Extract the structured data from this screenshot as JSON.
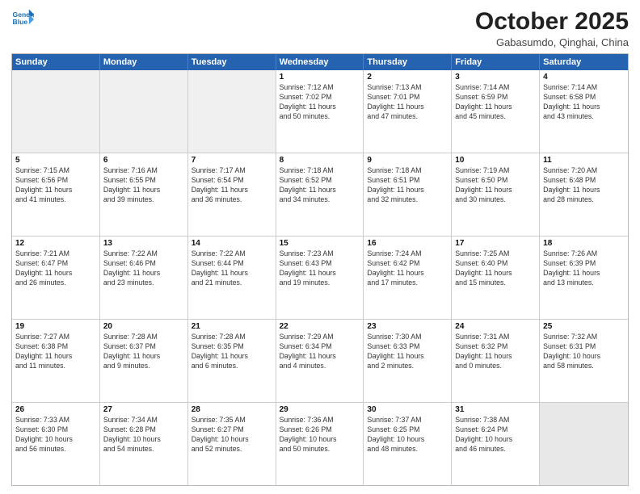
{
  "logo": {
    "line1": "General",
    "line2": "Blue"
  },
  "title": "October 2025",
  "location": "Gabasumdo, Qinghai, China",
  "days_of_week": [
    "Sunday",
    "Monday",
    "Tuesday",
    "Wednesday",
    "Thursday",
    "Friday",
    "Saturday"
  ],
  "weeks": [
    [
      {
        "day": "",
        "info": "",
        "empty": true
      },
      {
        "day": "",
        "info": "",
        "empty": true
      },
      {
        "day": "",
        "info": "",
        "empty": true
      },
      {
        "day": "1",
        "info": "Sunrise: 7:12 AM\nSunset: 7:02 PM\nDaylight: 11 hours\nand 50 minutes."
      },
      {
        "day": "2",
        "info": "Sunrise: 7:13 AM\nSunset: 7:01 PM\nDaylight: 11 hours\nand 47 minutes."
      },
      {
        "day": "3",
        "info": "Sunrise: 7:14 AM\nSunset: 6:59 PM\nDaylight: 11 hours\nand 45 minutes."
      },
      {
        "day": "4",
        "info": "Sunrise: 7:14 AM\nSunset: 6:58 PM\nDaylight: 11 hours\nand 43 minutes."
      }
    ],
    [
      {
        "day": "5",
        "info": "Sunrise: 7:15 AM\nSunset: 6:56 PM\nDaylight: 11 hours\nand 41 minutes."
      },
      {
        "day": "6",
        "info": "Sunrise: 7:16 AM\nSunset: 6:55 PM\nDaylight: 11 hours\nand 39 minutes."
      },
      {
        "day": "7",
        "info": "Sunrise: 7:17 AM\nSunset: 6:54 PM\nDaylight: 11 hours\nand 36 minutes."
      },
      {
        "day": "8",
        "info": "Sunrise: 7:18 AM\nSunset: 6:52 PM\nDaylight: 11 hours\nand 34 minutes."
      },
      {
        "day": "9",
        "info": "Sunrise: 7:18 AM\nSunset: 6:51 PM\nDaylight: 11 hours\nand 32 minutes."
      },
      {
        "day": "10",
        "info": "Sunrise: 7:19 AM\nSunset: 6:50 PM\nDaylight: 11 hours\nand 30 minutes."
      },
      {
        "day": "11",
        "info": "Sunrise: 7:20 AM\nSunset: 6:48 PM\nDaylight: 11 hours\nand 28 minutes."
      }
    ],
    [
      {
        "day": "12",
        "info": "Sunrise: 7:21 AM\nSunset: 6:47 PM\nDaylight: 11 hours\nand 26 minutes."
      },
      {
        "day": "13",
        "info": "Sunrise: 7:22 AM\nSunset: 6:46 PM\nDaylight: 11 hours\nand 23 minutes."
      },
      {
        "day": "14",
        "info": "Sunrise: 7:22 AM\nSunset: 6:44 PM\nDaylight: 11 hours\nand 21 minutes."
      },
      {
        "day": "15",
        "info": "Sunrise: 7:23 AM\nSunset: 6:43 PM\nDaylight: 11 hours\nand 19 minutes."
      },
      {
        "day": "16",
        "info": "Sunrise: 7:24 AM\nSunset: 6:42 PM\nDaylight: 11 hours\nand 17 minutes."
      },
      {
        "day": "17",
        "info": "Sunrise: 7:25 AM\nSunset: 6:40 PM\nDaylight: 11 hours\nand 15 minutes."
      },
      {
        "day": "18",
        "info": "Sunrise: 7:26 AM\nSunset: 6:39 PM\nDaylight: 11 hours\nand 13 minutes."
      }
    ],
    [
      {
        "day": "19",
        "info": "Sunrise: 7:27 AM\nSunset: 6:38 PM\nDaylight: 11 hours\nand 11 minutes."
      },
      {
        "day": "20",
        "info": "Sunrise: 7:28 AM\nSunset: 6:37 PM\nDaylight: 11 hours\nand 9 minutes."
      },
      {
        "day": "21",
        "info": "Sunrise: 7:28 AM\nSunset: 6:35 PM\nDaylight: 11 hours\nand 6 minutes."
      },
      {
        "day": "22",
        "info": "Sunrise: 7:29 AM\nSunset: 6:34 PM\nDaylight: 11 hours\nand 4 minutes."
      },
      {
        "day": "23",
        "info": "Sunrise: 7:30 AM\nSunset: 6:33 PM\nDaylight: 11 hours\nand 2 minutes."
      },
      {
        "day": "24",
        "info": "Sunrise: 7:31 AM\nSunset: 6:32 PM\nDaylight: 11 hours\nand 0 minutes."
      },
      {
        "day": "25",
        "info": "Sunrise: 7:32 AM\nSunset: 6:31 PM\nDaylight: 10 hours\nand 58 minutes."
      }
    ],
    [
      {
        "day": "26",
        "info": "Sunrise: 7:33 AM\nSunset: 6:30 PM\nDaylight: 10 hours\nand 56 minutes."
      },
      {
        "day": "27",
        "info": "Sunrise: 7:34 AM\nSunset: 6:28 PM\nDaylight: 10 hours\nand 54 minutes."
      },
      {
        "day": "28",
        "info": "Sunrise: 7:35 AM\nSunset: 6:27 PM\nDaylight: 10 hours\nand 52 minutes."
      },
      {
        "day": "29",
        "info": "Sunrise: 7:36 AM\nSunset: 6:26 PM\nDaylight: 10 hours\nand 50 minutes."
      },
      {
        "day": "30",
        "info": "Sunrise: 7:37 AM\nSunset: 6:25 PM\nDaylight: 10 hours\nand 48 minutes."
      },
      {
        "day": "31",
        "info": "Sunrise: 7:38 AM\nSunset: 6:24 PM\nDaylight: 10 hours\nand 46 minutes."
      },
      {
        "day": "",
        "info": "",
        "empty": true
      }
    ]
  ]
}
